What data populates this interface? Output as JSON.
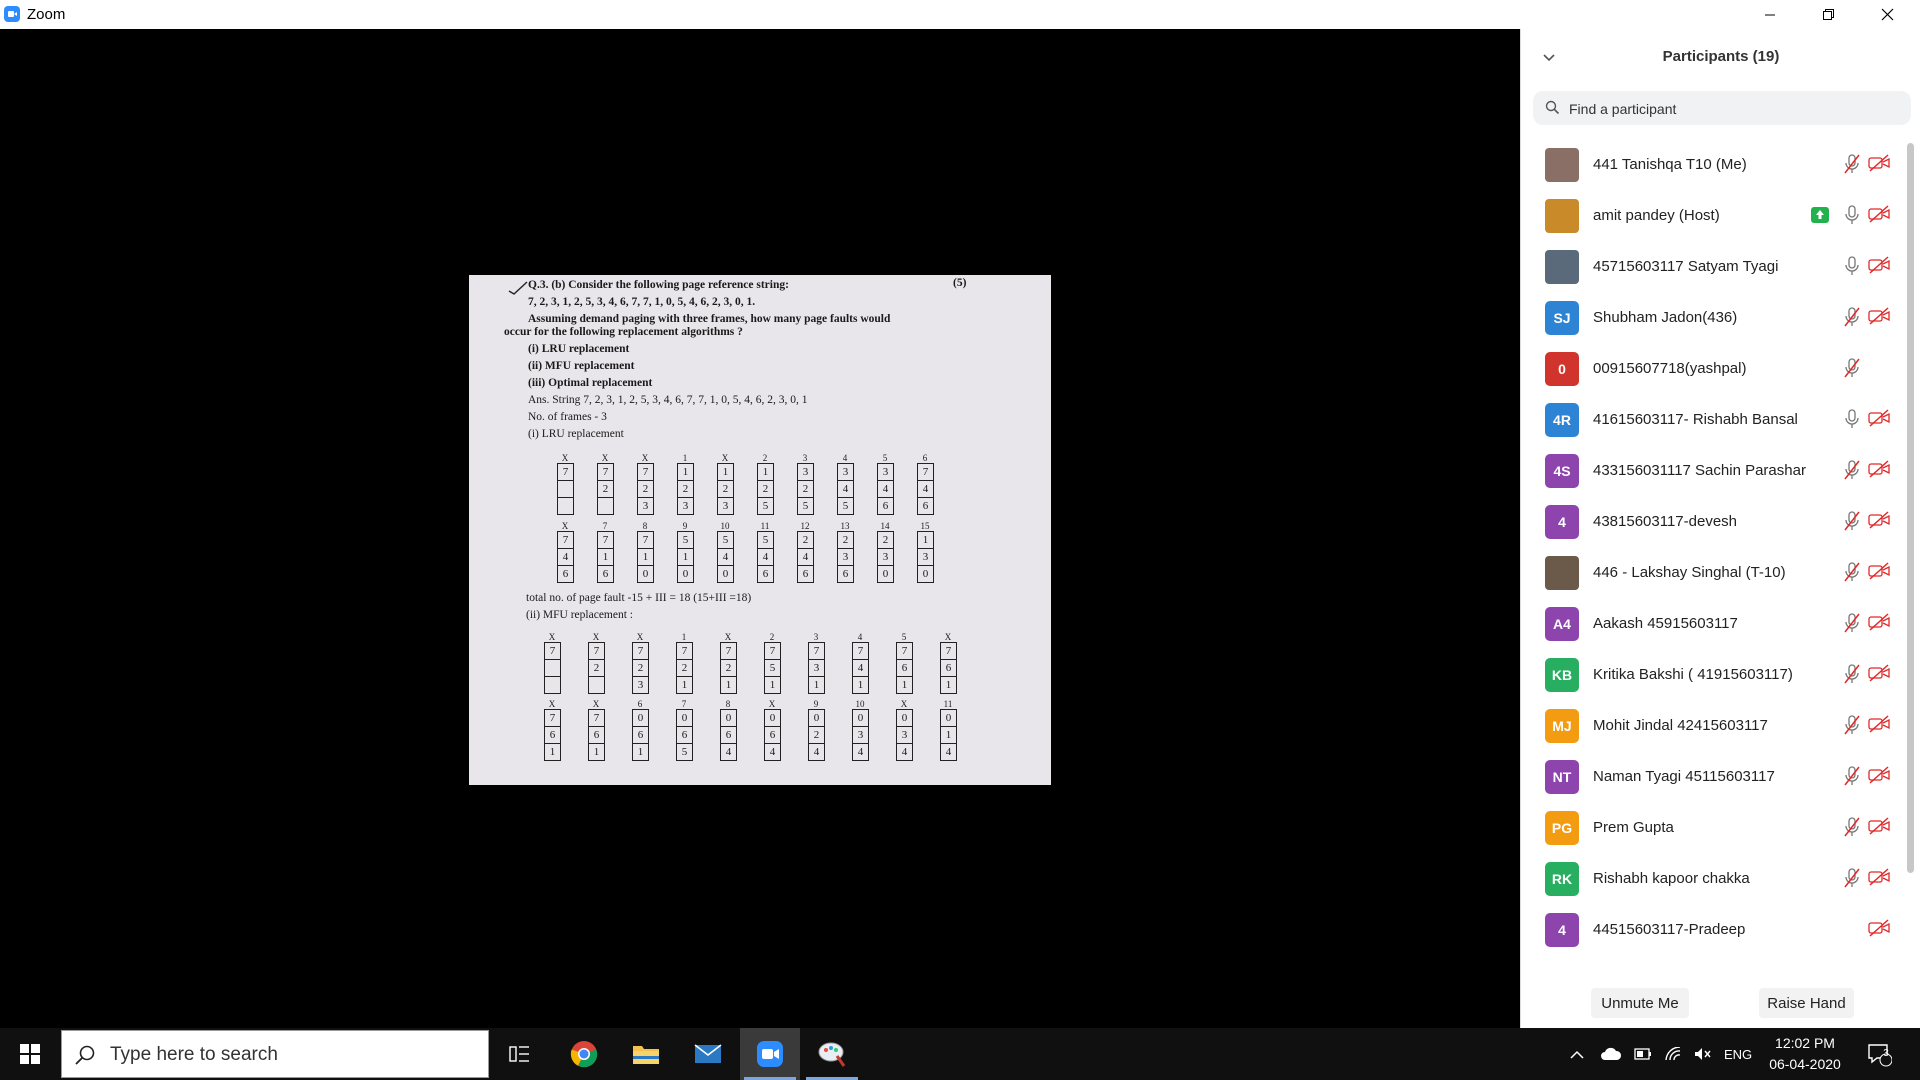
{
  "window": {
    "title": "Zoom"
  },
  "document": {
    "lines": [
      "Q.3. (b) Consider the following page reference string:",
      "7, 2, 3, 1, 2, 5, 3, 4, 6, 7, 7, 1, 0, 5, 4, 6, 2, 3, 0, 1.",
      "Assuming demand paging with three frames, how many page faults would",
      "occur for the following replacement algorithms ?",
      "(i) LRU replacement",
      "(ii) MFU replacement",
      "(iii) Optimal replacement",
      "Ans.  String 7, 2, 3, 1, 2, 5, 3, 4, 6, 7, 7, 1, 0, 5, 4, 6, 2, 3, 0, 1",
      "No. of frames - 3",
      "(i) LRU replacement",
      "total no. of page fault -15 + III = 18   (15+III =18)",
      "(ii) MFU replacement :"
    ],
    "marks": "(5)",
    "lru_row1": {
      "labels": [
        "X",
        "X",
        "X",
        "1",
        "X",
        "2",
        "3",
        "4",
        "5",
        "6"
      ],
      "frames": [
        [
          "7",
          "",
          ""
        ],
        [
          "7",
          "2",
          ""
        ],
        [
          "7",
          "2",
          "3"
        ],
        [
          "1",
          "2",
          "3"
        ],
        [
          "1",
          "2",
          "3"
        ],
        [
          "1",
          "2",
          "5"
        ],
        [
          "3",
          "2",
          "5"
        ],
        [
          "3",
          "4",
          "5"
        ],
        [
          "3",
          "4",
          "6"
        ],
        [
          "7",
          "4",
          "6"
        ]
      ]
    },
    "lru_row2": {
      "labels": [
        "X",
        "7",
        "8",
        "9",
        "10",
        "11",
        "12",
        "13",
        "14",
        "15"
      ],
      "frames": [
        [
          "7",
          "4",
          "6"
        ],
        [
          "7",
          "1",
          "6"
        ],
        [
          "7",
          "1",
          "0"
        ],
        [
          "5",
          "1",
          "0"
        ],
        [
          "5",
          "4",
          "0"
        ],
        [
          "5",
          "4",
          "6"
        ],
        [
          "2",
          "4",
          "6"
        ],
        [
          "2",
          "3",
          "6"
        ],
        [
          "2",
          "3",
          "0"
        ],
        [
          "1",
          "3",
          "0"
        ]
      ]
    },
    "mfu_row1": {
      "labels": [
        "X",
        "X",
        "X",
        "1",
        "X",
        "2",
        "3",
        "4",
        "5",
        "X"
      ],
      "frames": [
        [
          "7",
          "",
          ""
        ],
        [
          "7",
          "2",
          ""
        ],
        [
          "7",
          "2",
          "3"
        ],
        [
          "7",
          "2",
          "1"
        ],
        [
          "7",
          "2",
          "1"
        ],
        [
          "7",
          "5",
          "1"
        ],
        [
          "7",
          "3",
          "1"
        ],
        [
          "7",
          "4",
          "1"
        ],
        [
          "7",
          "6",
          "1"
        ],
        [
          "7",
          "6",
          "1"
        ]
      ]
    },
    "mfu_row2": {
      "labels": [
        "X",
        "X",
        "6",
        "7",
        "8",
        "X",
        "9",
        "10",
        "X",
        "11"
      ],
      "frames": [
        [
          "7",
          "6",
          "1"
        ],
        [
          "7",
          "6",
          "1"
        ],
        [
          "0",
          "6",
          "1"
        ],
        [
          "0",
          "6",
          "5"
        ],
        [
          "0",
          "6",
          "4"
        ],
        [
          "0",
          "6",
          "4"
        ],
        [
          "0",
          "2",
          "4"
        ],
        [
          "0",
          "3",
          "4"
        ],
        [
          "0",
          "3",
          "4"
        ],
        [
          "0",
          "1",
          "4"
        ]
      ]
    }
  },
  "participants_panel": {
    "title": "Participants (19)",
    "search_placeholder": "Find a participant",
    "participants": [
      {
        "name": "441 Tanishqa T10 (Me)",
        "initials": "",
        "color": "#8a6f66",
        "mic": "muted",
        "cam": "off"
      },
      {
        "name": "amit pandey (Host)",
        "initials": "",
        "color": "#c98b2a",
        "mic": "on",
        "cam": "off",
        "sharing": true
      },
      {
        "name": "45715603117 Satyam Tyagi",
        "initials": "",
        "color": "#5a6a7a",
        "mic": "on",
        "cam": "off"
      },
      {
        "name": "Shubham Jadon(436)",
        "initials": "SJ",
        "color": "#2d83d4",
        "mic": "muted",
        "cam": "off"
      },
      {
        "name": "00915607718(yashpal)",
        "initials": "0",
        "color": "#d0342c",
        "mic": "muted",
        "cam": "none"
      },
      {
        "name": "41615603117- Rishabh Bansal",
        "initials": "4R",
        "color": "#2d83d4",
        "mic": "on",
        "cam": "off"
      },
      {
        "name": "433156031117 Sachin Parashar",
        "initials": "4S",
        "color": "#8e44ad",
        "mic": "muted",
        "cam": "off"
      },
      {
        "name": "43815603117-devesh",
        "initials": "4",
        "color": "#8e44ad",
        "mic": "muted",
        "cam": "off"
      },
      {
        "name": "446 - Lakshay Singhal (T-10)",
        "initials": "",
        "color": "#6b5a4a",
        "mic": "muted",
        "cam": "off"
      },
      {
        "name": "Aakash 45915603117",
        "initials": "A4",
        "color": "#8e44ad",
        "mic": "muted",
        "cam": "off"
      },
      {
        "name": "Kritika Bakshi ( 41915603117)",
        "initials": "KB",
        "color": "#27ae60",
        "mic": "muted",
        "cam": "off"
      },
      {
        "name": "Mohit Jindal 42415603117",
        "initials": "MJ",
        "color": "#f39c12",
        "mic": "muted",
        "cam": "off"
      },
      {
        "name": "Naman Tyagi 45115603117",
        "initials": "NT",
        "color": "#8e44ad",
        "mic": "muted",
        "cam": "off"
      },
      {
        "name": "Prem Gupta",
        "initials": "PG",
        "color": "#f39c12",
        "mic": "muted",
        "cam": "off"
      },
      {
        "name": "Rishabh kapoor chakka",
        "initials": "RK",
        "color": "#27ae60",
        "mic": "muted",
        "cam": "off"
      },
      {
        "name": "44515603117-Pradeep",
        "initials": "4",
        "color": "#8e44ad",
        "mic": "none",
        "cam": "off"
      }
    ],
    "unmute_label": "Unmute Me",
    "raise_hand_label": "Raise Hand"
  },
  "taskbar": {
    "search_placeholder": "Type here to search",
    "language": "ENG",
    "time": "12:02 PM",
    "date": "06-04-2020",
    "notification_count": "3"
  }
}
